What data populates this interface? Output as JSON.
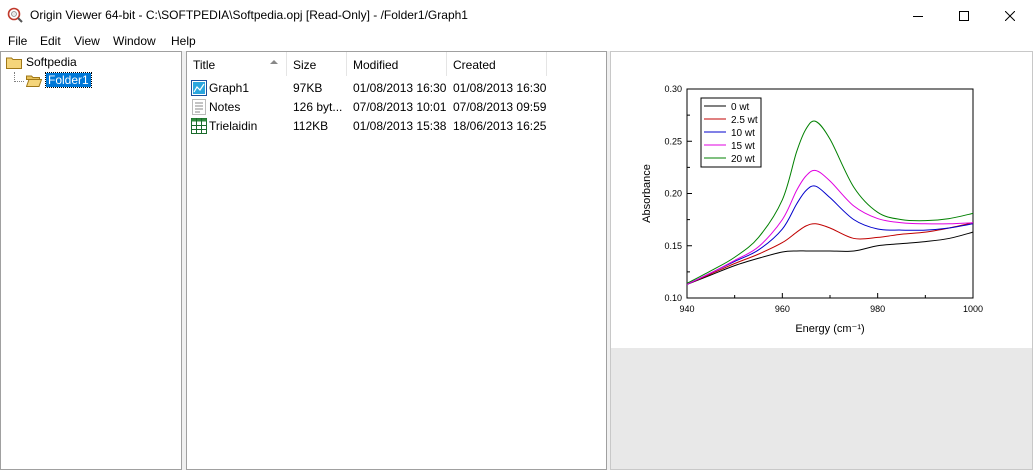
{
  "window": {
    "title": "Origin Viewer 64-bit - C:\\SOFTPEDIA\\Softpedia.opj [Read-Only] - /Folder1/Graph1"
  },
  "menu": [
    "File",
    "Edit",
    "View",
    "Window",
    "Help"
  ],
  "tree": {
    "root": "Softpedia",
    "child": "Folder1"
  },
  "list": {
    "columns": [
      "Title",
      "Size",
      "Modified",
      "Created"
    ],
    "rows": [
      {
        "icon": "graph-icon",
        "title": "Graph1",
        "size": "97KB",
        "modified": "01/08/2013 16:30",
        "created": "01/08/2013 16:30"
      },
      {
        "icon": "notes-icon",
        "title": "Notes",
        "size": "126 byt...",
        "modified": "07/08/2013 10:01",
        "created": "07/08/2013 09:59"
      },
      {
        "icon": "worksheet-icon",
        "title": "Trielaidin",
        "size": "112KB",
        "modified": "01/08/2013 15:38",
        "created": "18/06/2013 16:25"
      }
    ]
  },
  "chart_data": {
    "type": "line",
    "title": "",
    "xlabel": "Energy (cm⁻¹)",
    "ylabel": "Absorbance",
    "xlim": [
      940,
      1000
    ],
    "ylim": [
      0.1,
      0.3
    ],
    "xticks": [
      "940",
      "960",
      "980",
      "1000"
    ],
    "yticks": [
      "0.10",
      "0.15",
      "0.20",
      "0.25",
      "0.30"
    ],
    "legend_position": "top-left",
    "x": [
      940,
      945,
      950,
      955,
      960,
      963,
      965,
      967,
      970,
      975,
      980,
      985,
      990,
      995,
      1000
    ],
    "series": [
      {
        "name": "0 wt",
        "color": "#000000",
        "values": [
          0.113,
          0.122,
          0.131,
          0.138,
          0.144,
          0.145,
          0.145,
          0.145,
          0.145,
          0.145,
          0.15,
          0.152,
          0.154,
          0.157,
          0.163
        ]
      },
      {
        "name": "2.5 wt",
        "color": "#c00000",
        "values": [
          0.113,
          0.123,
          0.133,
          0.142,
          0.153,
          0.163,
          0.169,
          0.171,
          0.167,
          0.157,
          0.158,
          0.161,
          0.163,
          0.167,
          0.172
        ]
      },
      {
        "name": "10 wt",
        "color": "#0000cc",
        "values": [
          0.113,
          0.124,
          0.135,
          0.146,
          0.166,
          0.19,
          0.203,
          0.207,
          0.196,
          0.175,
          0.166,
          0.165,
          0.165,
          0.167,
          0.171
        ]
      },
      {
        "name": "15 wt",
        "color": "#e000e0",
        "values": [
          0.113,
          0.124,
          0.136,
          0.149,
          0.175,
          0.203,
          0.217,
          0.222,
          0.212,
          0.188,
          0.176,
          0.172,
          0.171,
          0.171,
          0.172
        ]
      },
      {
        "name": "20 wt",
        "color": "#008000",
        "values": [
          0.114,
          0.126,
          0.139,
          0.158,
          0.194,
          0.24,
          0.262,
          0.269,
          0.252,
          0.206,
          0.182,
          0.175,
          0.174,
          0.176,
          0.181
        ]
      }
    ]
  }
}
